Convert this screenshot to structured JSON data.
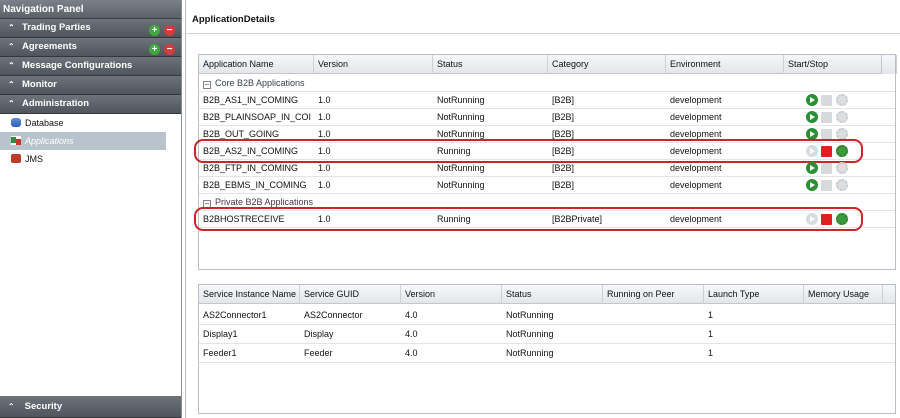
{
  "nav": {
    "title": "Navigation Panel",
    "headers": [
      {
        "label": "Trading Parties",
        "has_actions": true
      },
      {
        "label": "Agreements",
        "has_actions": true
      },
      {
        "label": "Message Configurations",
        "has_actions": false
      },
      {
        "label": "Monitor",
        "has_actions": false
      },
      {
        "label": "Administration",
        "has_actions": false
      }
    ],
    "tree": [
      {
        "label": "Database",
        "icon": "database-icon",
        "selected": false
      },
      {
        "label": "Applications",
        "icon": "applications-icon",
        "selected": true
      },
      {
        "label": "JMS",
        "icon": "jms-icon",
        "selected": false
      }
    ],
    "footer": {
      "label": "Security"
    },
    "chevron_up": "⌃",
    "add_symbol": "+",
    "remove_symbol": "−"
  },
  "main": {
    "title": "ApplicationDetails",
    "apps_grid": {
      "columns": [
        "Application Name",
        "Version",
        "Status",
        "Category",
        "Environment",
        "Start/Stop"
      ],
      "groups": [
        {
          "label": "Core B2B Applications",
          "rows": [
            {
              "name": "B2B_AS1_IN_COMING",
              "version": "1.0",
              "status": "NotRunning",
              "category": "[B2B]",
              "environment": "development",
              "running": false,
              "highlighted": false
            },
            {
              "name": "B2B_PLAINSOAP_IN_COI",
              "version": "1.0",
              "status": "NotRunning",
              "category": "[B2B]",
              "environment": "development",
              "running": false,
              "highlighted": false
            },
            {
              "name": "B2B_OUT_GOING",
              "version": "1.0",
              "status": "NotRunning",
              "category": "[B2B]",
              "environment": "development",
              "running": false,
              "highlighted": false
            },
            {
              "name": "B2B_AS2_IN_COMING",
              "version": "1.0",
              "status": "Running",
              "category": "[B2B]",
              "environment": "development",
              "running": true,
              "highlighted": true
            },
            {
              "name": "B2B_FTP_IN_COMING",
              "version": "1.0",
              "status": "NotRunning",
              "category": "[B2B]",
              "environment": "development",
              "running": false,
              "highlighted": false
            },
            {
              "name": "B2B_EBMS_IN_COMING",
              "version": "1.0",
              "status": "NotRunning",
              "category": "[B2B]",
              "environment": "development",
              "running": false,
              "highlighted": false
            }
          ]
        },
        {
          "label": "Private B2B Applications",
          "rows": [
            {
              "name": "B2BHOSTRECEIVE",
              "version": "1.0",
              "status": "Running",
              "category": "[B2BPrivate]",
              "environment": "development",
              "running": true,
              "highlighted": true
            }
          ]
        }
      ],
      "group_toggle": "−",
      "highlight_color": "#c9252b",
      "start_color": "#2b8f35",
      "stop_color": "#e0201e"
    },
    "services_grid": {
      "columns": [
        "Service Instance Name",
        "Service GUID",
        "Version",
        "Status",
        "Running on Peer",
        "Launch Type",
        "Memory Usage"
      ],
      "rows": [
        {
          "instance": "AS2Connector1",
          "guid": "AS2Connector",
          "version": "4.0",
          "status": "NotRunning",
          "peer": "",
          "launch": "1",
          "memory": ""
        },
        {
          "instance": "Display1",
          "guid": "Display",
          "version": "4.0",
          "status": "NotRunning",
          "peer": "",
          "launch": "1",
          "memory": ""
        },
        {
          "instance": "Feeder1",
          "guid": "Feeder",
          "version": "4.0",
          "status": "NotRunning",
          "peer": "",
          "launch": "1",
          "memory": ""
        }
      ]
    }
  }
}
